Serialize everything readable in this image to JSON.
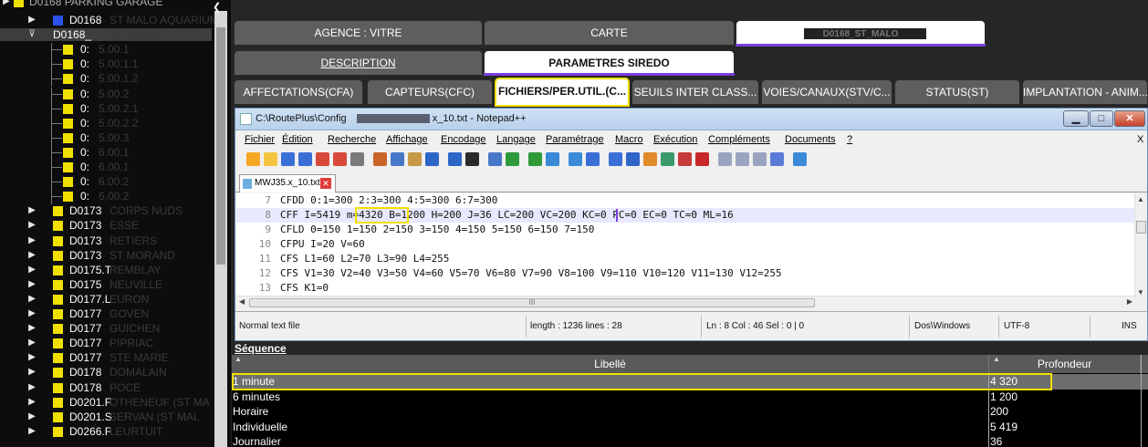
{
  "colors": {
    "accent": "#7b3fe0",
    "highlight": "#f0e000",
    "tree_square": "#f0e000",
    "tree_square_blue": "#2d52e8"
  },
  "tree": {
    "top_clip": "D0168 PARKING GARAGE",
    "rows": [
      {
        "code": "D0168",
        "name": "ST MALO AQUARIUM",
        "arrow": "▶",
        "square": "blue"
      },
      {
        "code": "D0168_",
        "name": "ST MALO",
        "arrow": "⊽",
        "square": "none",
        "selected": true
      },
      {
        "code": "0:",
        "name": "5.00.1"
      },
      {
        "code": "0:",
        "name": "5.00.1.1"
      },
      {
        "code": "0:",
        "name": "5.00.1.2"
      },
      {
        "code": "0:",
        "name": "5.00.2"
      },
      {
        "code": "0:",
        "name": "5.00.2.1"
      },
      {
        "code": "0:",
        "name": "5.00.2.2"
      },
      {
        "code": "0:",
        "name": "5.00.3"
      },
      {
        "code": "0:",
        "name": "6.00.1"
      },
      {
        "code": "0:",
        "name": "6.00.1"
      },
      {
        "code": "0:",
        "name": "6.00.2"
      },
      {
        "code": "0:",
        "name": "6.00.2"
      },
      {
        "code": "D0173",
        "name": "CORPS NUDS",
        "arrow": "▶"
      },
      {
        "code": "D0173",
        "name": "ESSE",
        "arrow": "▶"
      },
      {
        "code": "D0173",
        "name": "RETIERS",
        "arrow": "▶"
      },
      {
        "code": "D0173",
        "name": "ST MORAND",
        "arrow": "▶"
      },
      {
        "code": "D0175.T",
        "name": "REMBLAY",
        "arrow": "▶"
      },
      {
        "code": "D0175",
        "name": "NEUVILLE",
        "arrow": "▶"
      },
      {
        "code": "D0177.L",
        "name": "EURON",
        "arrow": "▶"
      },
      {
        "code": "D0177",
        "name": "GOVEN",
        "arrow": "▶"
      },
      {
        "code": "D0177",
        "name": "GUICHEN",
        "arrow": "▶"
      },
      {
        "code": "D0177",
        "name": "PIPRIAC",
        "arrow": "▶"
      },
      {
        "code": "D0177",
        "name": "STE MARIE",
        "arrow": "▶"
      },
      {
        "code": "D0178",
        "name": "DOMALAIN",
        "arrow": "▶"
      },
      {
        "code": "D0178",
        "name": "POCE",
        "arrow": "▶"
      },
      {
        "code": "D0201.F",
        "name": "OTHENEUF (ST MA",
        "arrow": "▶"
      },
      {
        "code": "D0201.S",
        "name": "SERVAN (ST MAL",
        "arrow": "▶"
      },
      {
        "code": "D0266.F",
        "name": "LEURTUIT",
        "arrow": "▶"
      }
    ]
  },
  "tabs_row1": [
    "AGENCE : VITRE",
    "CARTE",
    "D0168_ST_MALO"
  ],
  "tabs_row2": [
    "DESCRIPTION",
    "PARAMETRES SIREDO"
  ],
  "tabs_row3": [
    "AFFECTATIONS(CFA)",
    "CAPTEURS(CFC)",
    "FICHIERS/PER.UTIL.(C...",
    "SEUILS INTER CLASS...",
    "VOIES/CANAUX(STV/C...",
    "STATUS(ST)",
    "IMPLANTATION - ANIM..."
  ],
  "notepad": {
    "title": "C:\\RoutePlus\\Config",
    "title_suffix": "x_10.txt - Notepad++",
    "menu": [
      "Fichier",
      "Édition",
      "Recherche",
      "Affichage",
      "Encodage",
      "Langage",
      "Paramétrage",
      "Macro",
      "Exécution",
      "Compléments",
      "Documents",
      "?"
    ],
    "menu_close": "X",
    "file_tab": "MWJ35.x_10.txt",
    "lines": [
      {
        "n": "7",
        "text": "CFDD 0:1=300 2:3=300 4:5=300 6:7=300"
      },
      {
        "n": "8",
        "text": "CFF I=5419 m=4320 B=1200 H=200 J=36 LC=200 VC=200 KC=0 PC=0 EC=0 TC=0 ML=16"
      },
      {
        "n": "9",
        "text": "CFLD 0=150 1=150 2=150 3=150 4=150 5=150 6=150 7=150"
      },
      {
        "n": "10",
        "text": "CFPU I=20 V=60"
      },
      {
        "n": "11",
        "text": "CFS L1=60 L2=70 L3=90 L4=255"
      },
      {
        "n": "12",
        "text": "CFS V1=30 V2=40 V3=50 V4=60 V5=70 V6=80 V7=90 V8=100 V9=110 V10=120 V11=130 V12=255"
      },
      {
        "n": "13",
        "text": "CFS K1=0"
      }
    ],
    "hscroll_grip": "III",
    "status": {
      "type": "Normal text file",
      "length": "length : 1236   lines : 28",
      "pos": "Ln : 8   Col : 46   Sel : 0 | 0",
      "eol": "Dos\\Windows",
      "enc": "UTF-8",
      "mode": "INS"
    }
  },
  "sequence": {
    "label": "Séquence",
    "headers": {
      "libelle": "Libellé",
      "profondeur": "Profondeur"
    },
    "rows": [
      {
        "libelle": "1 minute",
        "profondeur": "4 320"
      },
      {
        "libelle": "6 minutes",
        "profondeur": "1 200"
      },
      {
        "libelle": "Horaire",
        "profondeur": "200"
      },
      {
        "libelle": "Individuelle",
        "profondeur": "5 419"
      },
      {
        "libelle": "Journalier",
        "profondeur": "36"
      }
    ]
  }
}
